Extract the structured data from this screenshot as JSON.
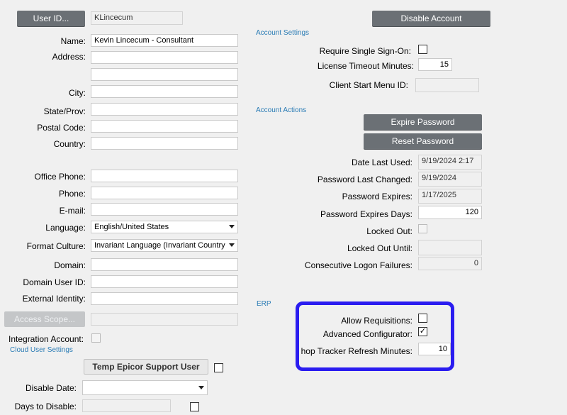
{
  "left": {
    "user_id_button": "User ID...",
    "user_id_value": "KLincecum",
    "name": {
      "label": "Name:",
      "value": "Kevin Lincecum - Consultant"
    },
    "address": {
      "label": "Address:",
      "value1": "",
      "value2": ""
    },
    "city": {
      "label": "City:",
      "value": ""
    },
    "state": {
      "label": "State/Prov:",
      "value": ""
    },
    "postal": {
      "label": "Postal Code:",
      "value": ""
    },
    "country": {
      "label": "Country:",
      "value": ""
    },
    "office_phone": {
      "label": "Office Phone:",
      "value": ""
    },
    "phone": {
      "label": "Phone:",
      "value": ""
    },
    "email": {
      "label": "E-mail:",
      "value": ""
    },
    "language": {
      "label": "Language:",
      "value": "English/United States"
    },
    "format_culture": {
      "label": "Format Culture:",
      "value": "Invariant Language (Invariant Country"
    },
    "domain": {
      "label": "Domain:",
      "value": ""
    },
    "domain_user_id": {
      "label": "Domain User ID:",
      "value": ""
    },
    "external_identity": {
      "label": "External Identity:",
      "value": ""
    },
    "access_scope_button": "Access Scope...",
    "integration_account": {
      "label": "Integration Account:",
      "checked": false
    },
    "cloud_user_settings": "Cloud User Settings",
    "temp_support_button": "Temp Epicor Support User",
    "temp_support_checked": false,
    "disable_date": {
      "label": "Disable Date:",
      "value": ""
    },
    "days_to_disable": {
      "label": "Days to Disable:",
      "value": "",
      "checked": false
    }
  },
  "right": {
    "disable_account_button": "Disable Account",
    "account_settings_header": "Account Settings",
    "require_sso": {
      "label": "Require Single Sign-On:",
      "checked": false
    },
    "license_timeout": {
      "label": "License Timeout Minutes:",
      "value": "15"
    },
    "client_start_menu": {
      "label": "Client Start Menu ID:",
      "value": ""
    },
    "account_actions_header": "Account Actions",
    "expire_password_button": "Expire Password",
    "reset_password_button": "Reset Password",
    "date_last_used": {
      "label": "Date Last Used:",
      "value": "9/19/2024 2:17"
    },
    "password_last_changed": {
      "label": "Password Last Changed:",
      "value": "9/19/2024"
    },
    "password_expires": {
      "label": "Password Expires:",
      "value": "1/17/2025"
    },
    "password_expires_days": {
      "label": "Password Expires Days:",
      "value": "120"
    },
    "locked_out": {
      "label": "Locked Out:",
      "checked": false
    },
    "locked_out_until": {
      "label": "Locked Out Until:",
      "value": ""
    },
    "consecutive_failures": {
      "label": "Consecutive Logon Failures:",
      "value": "0"
    },
    "erp_header": "ERP",
    "allow_requisitions": {
      "label": "Allow Requisitions:",
      "checked": false,
      "mark": ""
    },
    "advanced_configurator": {
      "label": "Advanced Configurator:",
      "checked": true,
      "mark": "✓"
    },
    "shop_tracker_refresh": {
      "label": "hop Tracker Refresh Minutes:",
      "value": "10"
    }
  },
  "colors": {
    "button": "#6b7075",
    "section_header": "#2b7cb5",
    "highlight": "#2a1cf0"
  }
}
